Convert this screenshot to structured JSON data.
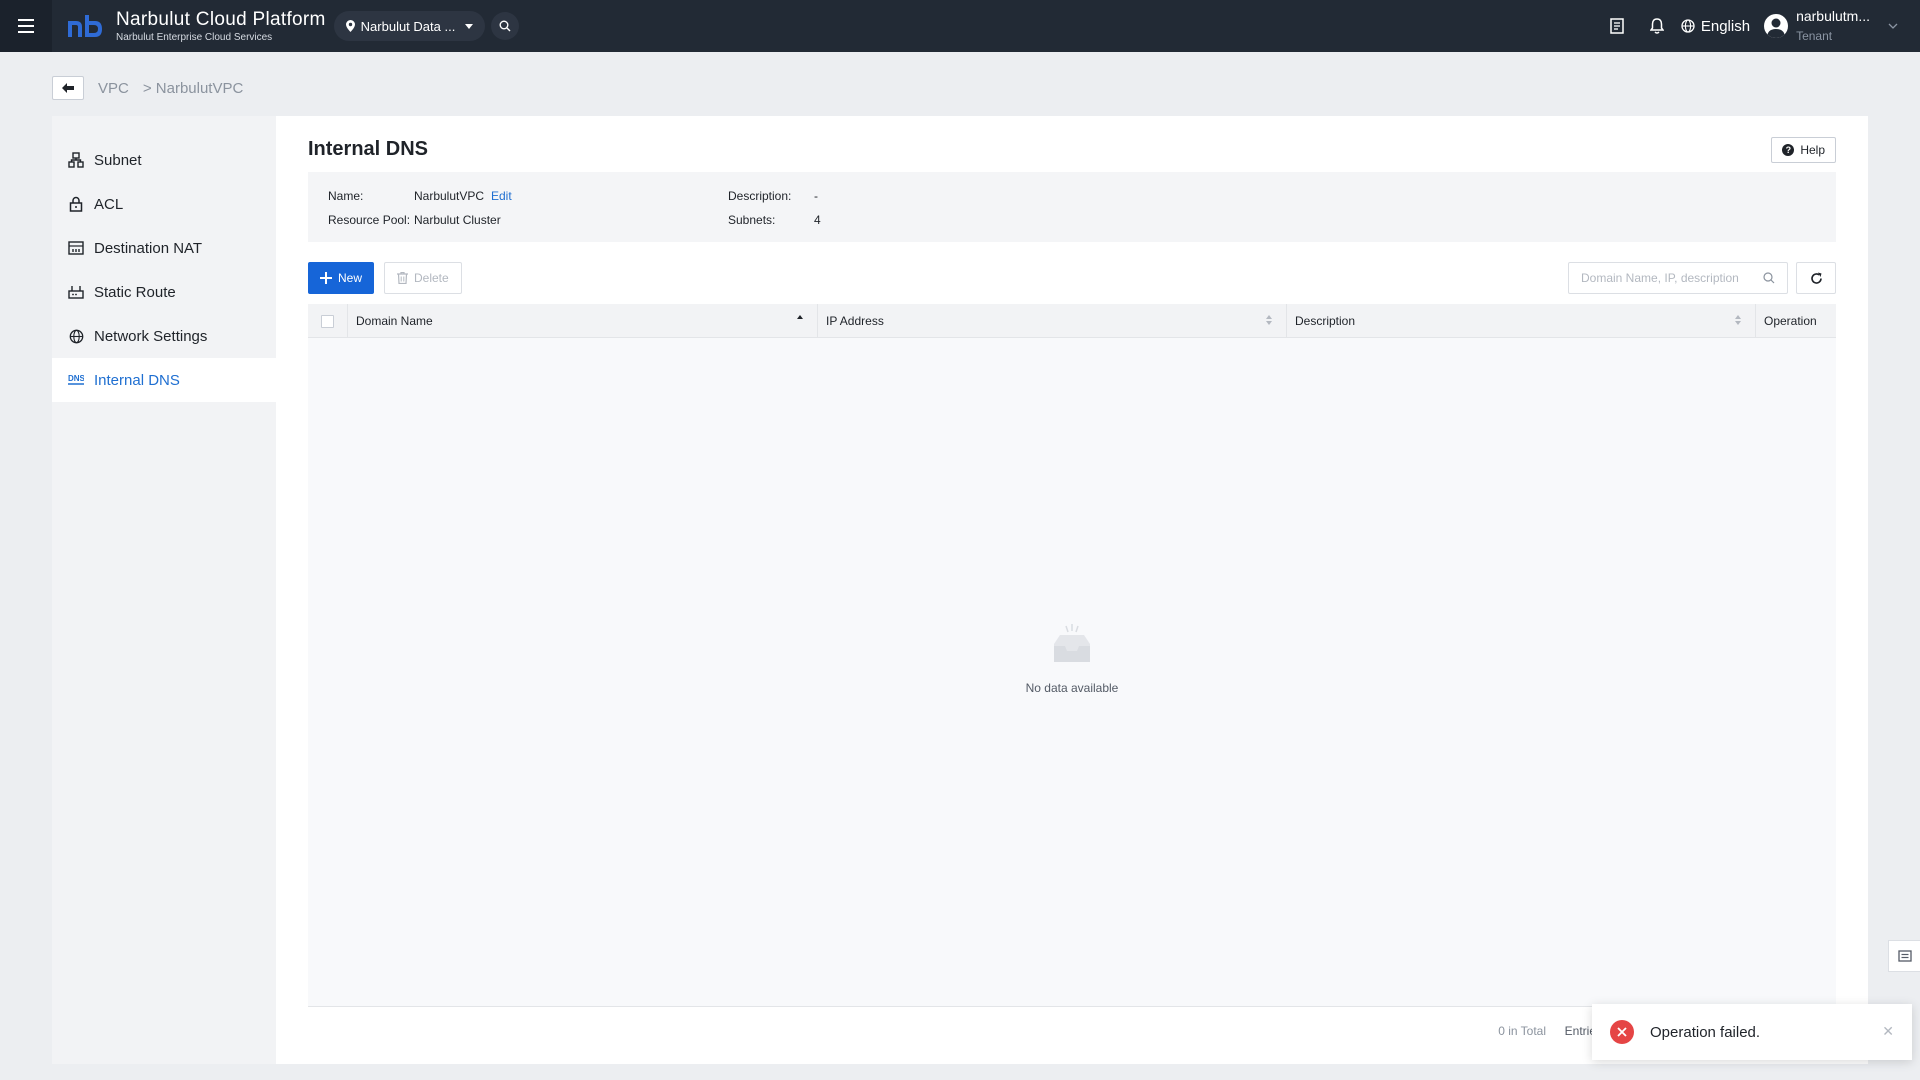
{
  "app": {
    "title": "Narbulut Cloud Platform",
    "subtitle": "Narbulut Enterprise Cloud Services",
    "region": "Narbulut Data ...",
    "language": "English",
    "user_name": "narbulutm...",
    "user_role": "Tenant"
  },
  "breadcrumb": {
    "items": [
      "VPC",
      "NarbulutVPC"
    ],
    "separator": ">"
  },
  "sidebar": {
    "items": [
      {
        "label": "Subnet",
        "icon": "subnet-icon"
      },
      {
        "label": "ACL",
        "icon": "lock-icon"
      },
      {
        "label": "Destination NAT",
        "icon": "nat-icon"
      },
      {
        "label": "Static Route",
        "icon": "route-icon"
      },
      {
        "label": "Network Settings",
        "icon": "globe-icon"
      },
      {
        "label": "Internal DNS",
        "icon": "dns-icon",
        "active": true
      }
    ]
  },
  "page": {
    "title": "Internal DNS",
    "help_label": "Help"
  },
  "info": {
    "name_label": "Name:",
    "name_value": "NarbulutVPC",
    "edit_label": "Edit",
    "pool_label": "Resource Pool:",
    "pool_value": "Narbulut Cluster",
    "desc_label": "Description:",
    "desc_value": "-",
    "subnets_label": "Subnets:",
    "subnets_value": "4"
  },
  "toolbar": {
    "new_label": "New",
    "delete_label": "Delete",
    "search_placeholder": "Domain Name, IP, description"
  },
  "table": {
    "columns": [
      "Domain Name",
      "IP Address",
      "Description",
      "Operation"
    ],
    "rows": [],
    "empty_text": "No data available"
  },
  "pagination": {
    "total": "0 in Total",
    "entries_label": "Entrie"
  },
  "toast": {
    "message": "Operation failed."
  },
  "colors": {
    "topbar": "#222a35",
    "accent": "#1665d8",
    "error": "#e54545"
  }
}
